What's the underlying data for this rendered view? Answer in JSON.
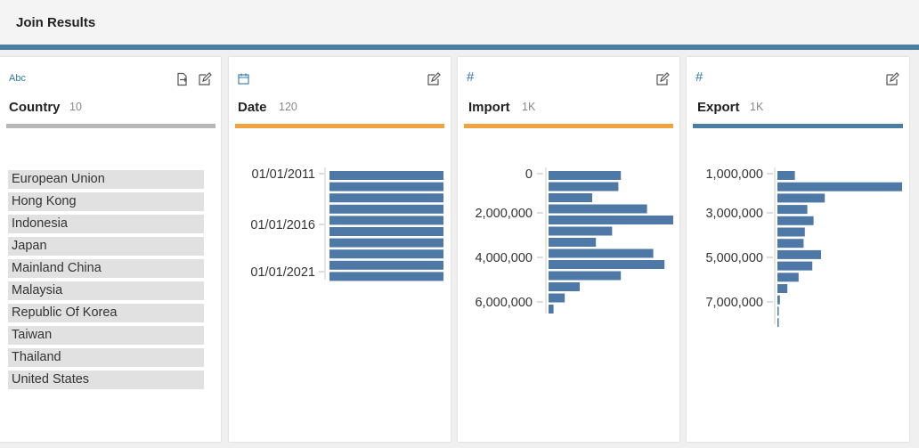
{
  "header": {
    "title": "Join Results"
  },
  "colors": {
    "accent": "#4a7fa1",
    "bar": "#4e79a7",
    "orange": "#f1a340",
    "gray": "#b7b7b7",
    "value_bg": "#e1e1e1"
  },
  "columns": [
    {
      "name": "Country",
      "count": "10",
      "type_icon": "string-type-icon",
      "type_label": "Abc",
      "bar_color": "#b7b7b7",
      "values": [
        "European Union",
        "Hong Kong",
        "Indonesia",
        "Japan",
        "Mainland China",
        "Malaysia",
        "Republic Of Korea",
        "Taiwan",
        "Thailand",
        "United States"
      ]
    },
    {
      "name": "Date",
      "count": "120",
      "type_icon": "calendar-icon",
      "bar_color": "#f1a340",
      "chart_labels": [
        "01/01/2011",
        "01/01/2016",
        "01/01/2021"
      ]
    },
    {
      "name": "Import",
      "count": "1K",
      "type_icon": "number-type-icon",
      "type_label": "#",
      "bar_color": "#f1a340",
      "chart_labels": [
        "0",
        "2,000,000",
        "4,000,000",
        "6,000,000"
      ]
    },
    {
      "name": "Export",
      "count": "1K",
      "type_icon": "number-type-icon",
      "type_label": "#",
      "bar_color": "#4a7fa1",
      "chart_labels": [
        "1,000,000",
        "3,000,000",
        "5,000,000",
        "7,000,000"
      ]
    }
  ],
  "chart_data": [
    {
      "type": "bar",
      "orientation": "horizontal",
      "title": "Date",
      "y_labels": [
        "01/01/2011",
        "01/01/2016",
        "01/01/2021"
      ],
      "values": [
        1,
        1,
        1,
        1,
        1,
        1,
        1,
        1,
        1,
        1
      ]
    },
    {
      "type": "bar",
      "orientation": "horizontal",
      "title": "Import",
      "y_labels": [
        "0",
        "2,000,000",
        "4,000,000",
        "6,000,000"
      ],
      "values": [
        0.58,
        0.56,
        0.35,
        0.79,
        1.0,
        0.51,
        0.38,
        0.84,
        0.93,
        0.58,
        0.25,
        0.13,
        0.04
      ]
    },
    {
      "type": "bar",
      "orientation": "horizontal",
      "title": "Export",
      "y_labels": [
        "1,000,000",
        "3,000,000",
        "5,000,000",
        "7,000,000"
      ],
      "values": [
        0.14,
        1.0,
        0.38,
        0.24,
        0.29,
        0.22,
        0.21,
        0.35,
        0.28,
        0.17,
        0.08,
        0.02,
        0.01,
        0.01
      ]
    }
  ]
}
